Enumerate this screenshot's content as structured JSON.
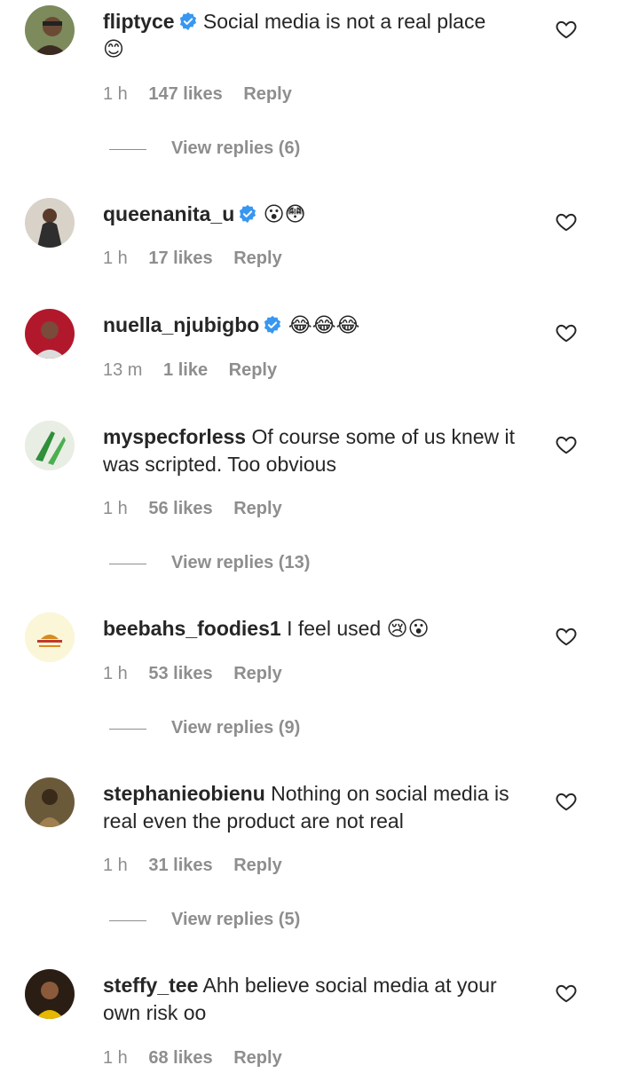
{
  "comments": [
    {
      "username": "fliptyce",
      "verified": true,
      "text": "Social media is not a real place",
      "emoji": "😊",
      "time": "1 h",
      "likes": "147 likes",
      "reply": "Reply",
      "view_replies": "View replies (6)",
      "avatar_color": "#5a6b3c"
    },
    {
      "username": "queenanita_u",
      "verified": true,
      "text": "",
      "emoji": "😮😳",
      "time": "1 h",
      "likes": "17 likes",
      "reply": "Reply",
      "view_replies": "",
      "avatar_color": "#8a7d72"
    },
    {
      "username": "nuella_njubigbo",
      "verified": true,
      "text": "",
      "emoji": "😂😂😂",
      "time": "13 m",
      "likes": "1 like",
      "reply": "Reply",
      "view_replies": "",
      "avatar_color": "#b2182b"
    },
    {
      "username": "myspecforless",
      "verified": false,
      "text": "Of course some of us knew it was scripted. Too obvious",
      "emoji": "",
      "time": "1 h",
      "likes": "56 likes",
      "reply": "Reply",
      "view_replies": "View replies (13)",
      "avatar_color": "#6f9b5a"
    },
    {
      "username": "beebahs_foodies1",
      "verified": false,
      "text": "I feel used",
      "emoji": "😢😮",
      "time": "1 h",
      "likes": "53 likes",
      "reply": "Reply",
      "view_replies": "View replies (9)",
      "avatar_color": "#fbf6d8"
    },
    {
      "username": "stephanieobienu",
      "verified": false,
      "text": "Nothing on social media is real even the product are not real",
      "emoji": "",
      "time": "1 h",
      "likes": "31 likes",
      "reply": "Reply",
      "view_replies": "View replies (5)",
      "avatar_color": "#5b4a2f"
    },
    {
      "username": "steffy_tee",
      "verified": false,
      "text": "Ahh believe social media at your own risk oo",
      "emoji": "",
      "time": "1 h",
      "likes": "68 likes",
      "reply": "Reply",
      "view_replies": "",
      "avatar_color": "#3a2a1f"
    }
  ],
  "colors": {
    "verified": "#3897f0",
    "secondary_text": "#8e8e8e",
    "primary_text": "#262626"
  },
  "icons": {
    "like": "heart-outline-icon",
    "verified": "verified-badge-icon"
  }
}
